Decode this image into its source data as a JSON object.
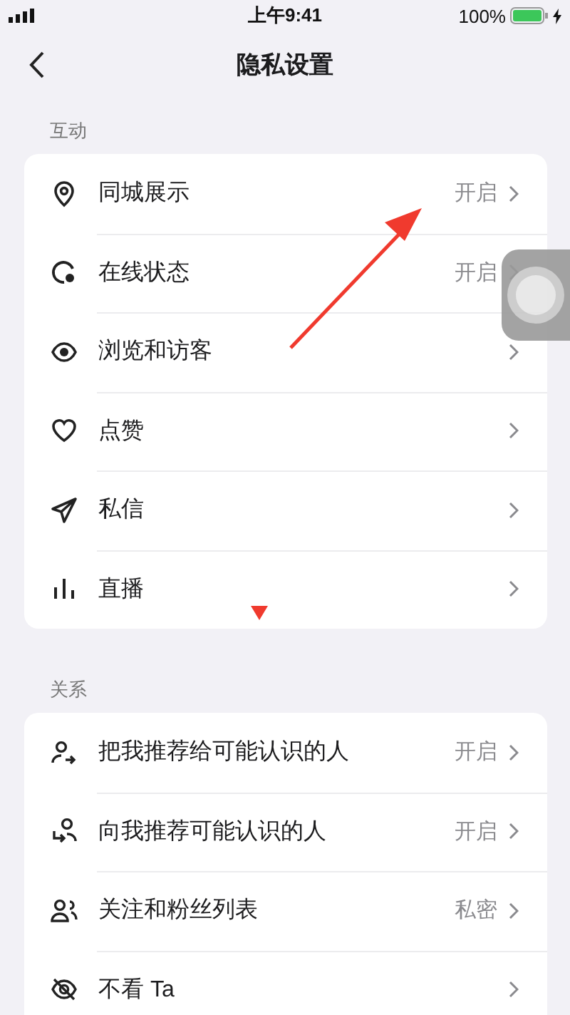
{
  "status_bar": {
    "time": "上午9:41",
    "battery": "100%"
  },
  "nav": {
    "title": "隐私设置"
  },
  "sections": [
    {
      "label": "互动",
      "rows": [
        {
          "label": "同城展示",
          "value": "开启"
        },
        {
          "label": "在线状态",
          "value": "开启"
        },
        {
          "label": "浏览和访客"
        },
        {
          "label": "点赞"
        },
        {
          "label": "私信"
        },
        {
          "label": "直播"
        }
      ]
    },
    {
      "label": "关系",
      "rows": [
        {
          "label": "把我推荐给可能认识的人",
          "value": "开启"
        },
        {
          "label": "向我推荐可能认识的人",
          "value": "开启"
        },
        {
          "label": "关注和粉丝列表",
          "value": "私密"
        },
        {
          "label": "不看 Ta"
        }
      ]
    }
  ]
}
